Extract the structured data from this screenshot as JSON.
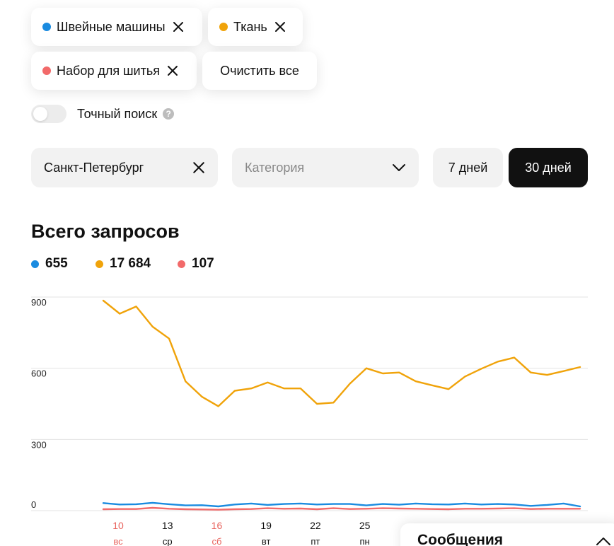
{
  "filters": {
    "chips": [
      {
        "label": "Швейные машины",
        "color": "#1a8be0"
      },
      {
        "label": "Ткань",
        "color": "#f0a30a"
      },
      {
        "label": "Набор для шитья",
        "color": "#f26a6a"
      }
    ],
    "clear_all": "Очистить все"
  },
  "exact_search": {
    "label": "Точный поиск",
    "enabled": false,
    "help": "?"
  },
  "region": {
    "value": "Санкт-Петербург"
  },
  "category": {
    "placeholder": "Категория"
  },
  "period": {
    "options": [
      "7 дней",
      "30 дней"
    ],
    "selected": "30 дней"
  },
  "chart_title": "Всего запросов",
  "totals": [
    {
      "value": "655",
      "color": "#1a8be0"
    },
    {
      "value": "17 684",
      "color": "#f0a30a"
    },
    {
      "value": "107",
      "color": "#f26a6a"
    }
  ],
  "chart_data": {
    "type": "line",
    "ylim": [
      0,
      900
    ],
    "yticks": [
      0,
      300,
      600,
      900
    ],
    "grid": true,
    "x_labels": [
      {
        "day": "10",
        "weekday": "вс",
        "weekend": true
      },
      {
        "day": "13",
        "weekday": "ср",
        "weekend": false
      },
      {
        "day": "16",
        "weekday": "сб",
        "weekend": true
      },
      {
        "day": "19",
        "weekday": "вт",
        "weekend": false
      },
      {
        "day": "22",
        "weekday": "пт",
        "weekend": false
      },
      {
        "day": "25",
        "weekday": "пн",
        "weekend": false
      }
    ],
    "series": [
      {
        "color": "#f0a30a",
        "values": [
          885,
          830,
          860,
          775,
          725,
          545,
          480,
          440,
          505,
          515,
          540,
          515,
          515,
          450,
          455,
          535,
          600,
          578,
          582,
          545,
          528,
          512,
          565,
          598,
          628,
          645,
          582,
          572,
          588,
          605
        ]
      },
      {
        "color": "#1a8be0",
        "values": [
          32,
          26,
          27,
          33,
          27,
          22,
          23,
          18,
          26,
          30,
          24,
          28,
          30,
          26,
          28,
          28,
          22,
          28,
          25,
          30,
          27,
          26,
          30,
          26,
          28,
          26,
          20,
          24,
          30,
          18
        ]
      },
      {
        "color": "#f26a6a",
        "values": [
          6,
          7,
          7,
          12,
          8,
          6,
          5,
          4,
          6,
          7,
          10,
          8,
          9,
          6,
          10,
          7,
          8,
          10,
          9,
          8,
          7,
          6,
          8,
          8,
          9,
          10,
          7,
          8,
          8,
          8
        ]
      }
    ]
  },
  "messages": {
    "title": "Сообщения"
  },
  "colors": {
    "weekend": "#e8625c",
    "dark_button": "#111111"
  }
}
